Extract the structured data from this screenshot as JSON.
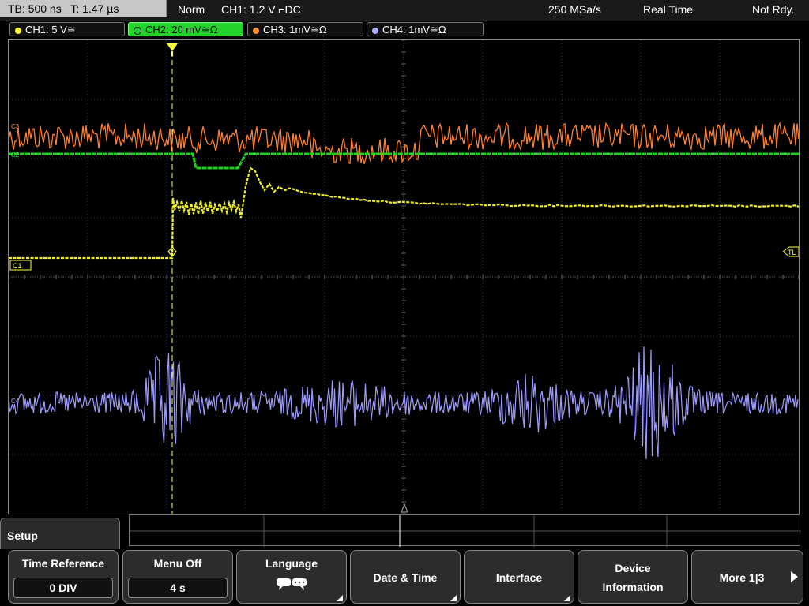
{
  "status": {
    "timebase": "TB: 500 ns",
    "trigger_time": "T: 1.47 µs",
    "mode": "Norm",
    "trigger": "CH1: 1.2 V ⌐DC",
    "sample_rate": "250 MSa/s",
    "acquisition": "Real Time",
    "state": "Not Rdy."
  },
  "channels": [
    {
      "label": "CH1: 5 V≅",
      "color": "#ffff30"
    },
    {
      "label": "CH2: 20 mV≅Ω",
      "color": "#22d42a"
    },
    {
      "label": "CH3: 1mV≅Ω",
      "color": "#ff8c30"
    },
    {
      "label": "CH4: 1mV≅Ω",
      "color": "#a9a9ff"
    }
  ],
  "markers": {
    "c1": "C1",
    "tl": "TL",
    "c2": "C2",
    "c3": "C3",
    "c4": "C4"
  },
  "menu": {
    "title": "Setup",
    "softkeys": [
      {
        "label": "Time Reference",
        "value": "0 DIV"
      },
      {
        "label": "Menu Off",
        "value": "4 s"
      },
      {
        "label": "Language",
        "icon": "speech-bubble-icon"
      },
      {
        "label": "Date & Time"
      },
      {
        "label": "Interface"
      },
      {
        "label1": "Device",
        "label2": "Information"
      },
      {
        "label": "More 1|3"
      }
    ]
  }
}
